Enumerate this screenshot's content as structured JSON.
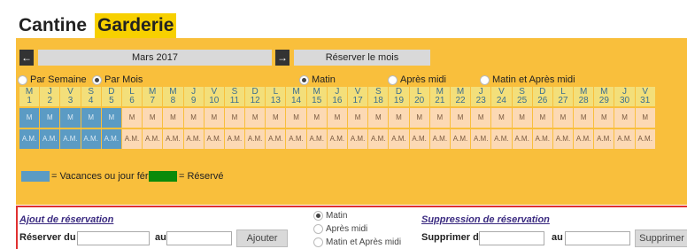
{
  "tabs": {
    "cantine": "Cantine",
    "garderie": "Garderie"
  },
  "nav": {
    "prev": "←",
    "month": "Mars 2017",
    "next": "→",
    "reserve_month": "Réserver le mois"
  },
  "view_options": {
    "per_week": "Par Semaine",
    "per_month": "Par Mois"
  },
  "period_options": {
    "morning": "Matin",
    "afternoon": "Après midi",
    "both": "Matin et Après midi"
  },
  "days": [
    {
      "l": "M",
      "n": "1",
      "vac": true
    },
    {
      "l": "J",
      "n": "2",
      "vac": true
    },
    {
      "l": "V",
      "n": "3",
      "vac": true
    },
    {
      "l": "S",
      "n": "4",
      "vac": true
    },
    {
      "l": "D",
      "n": "5",
      "vac": true
    },
    {
      "l": "L",
      "n": "6",
      "vac": false
    },
    {
      "l": "M",
      "n": "7",
      "vac": false
    },
    {
      "l": "M",
      "n": "8",
      "vac": false
    },
    {
      "l": "J",
      "n": "9",
      "vac": false
    },
    {
      "l": "V",
      "n": "10",
      "vac": false
    },
    {
      "l": "S",
      "n": "11",
      "vac": false
    },
    {
      "l": "D",
      "n": "12",
      "vac": false
    },
    {
      "l": "L",
      "n": "13",
      "vac": false
    },
    {
      "l": "M",
      "n": "14",
      "vac": false
    },
    {
      "l": "M",
      "n": "15",
      "vac": false
    },
    {
      "l": "J",
      "n": "16",
      "vac": false
    },
    {
      "l": "V",
      "n": "17",
      "vac": false
    },
    {
      "l": "S",
      "n": "18",
      "vac": false
    },
    {
      "l": "D",
      "n": "19",
      "vac": false
    },
    {
      "l": "L",
      "n": "20",
      "vac": false
    },
    {
      "l": "M",
      "n": "21",
      "vac": false
    },
    {
      "l": "M",
      "n": "22",
      "vac": false
    },
    {
      "l": "J",
      "n": "23",
      "vac": false
    },
    {
      "l": "V",
      "n": "24",
      "vac": false
    },
    {
      "l": "S",
      "n": "25",
      "vac": false
    },
    {
      "l": "D",
      "n": "26",
      "vac": false
    },
    {
      "l": "L",
      "n": "27",
      "vac": false
    },
    {
      "l": "M",
      "n": "28",
      "vac": false
    },
    {
      "l": "M",
      "n": "29",
      "vac": false
    },
    {
      "l": "J",
      "n": "30",
      "vac": false
    },
    {
      "l": "V",
      "n": "31",
      "vac": false
    }
  ],
  "morning_slot": "M",
  "am_slot": "A.M.",
  "legend": {
    "vacation": "= Vacances ou jour férié",
    "reserved": "= Réservé",
    "vacation_color": "#5b9bc4",
    "reserved_color": "#0a8a0a"
  },
  "add_form": {
    "title": "Ajout de réservation",
    "from_label": "Réserver du",
    "to_label": "au",
    "button": "Ajouter"
  },
  "form_periods": {
    "morning": "Matin",
    "afternoon": "Après midi",
    "both": "Matin et Après midi"
  },
  "delete_form": {
    "title": "Suppression de réservation",
    "from_label": "Supprimer du",
    "to_label": "au",
    "button": "Supprimer"
  }
}
